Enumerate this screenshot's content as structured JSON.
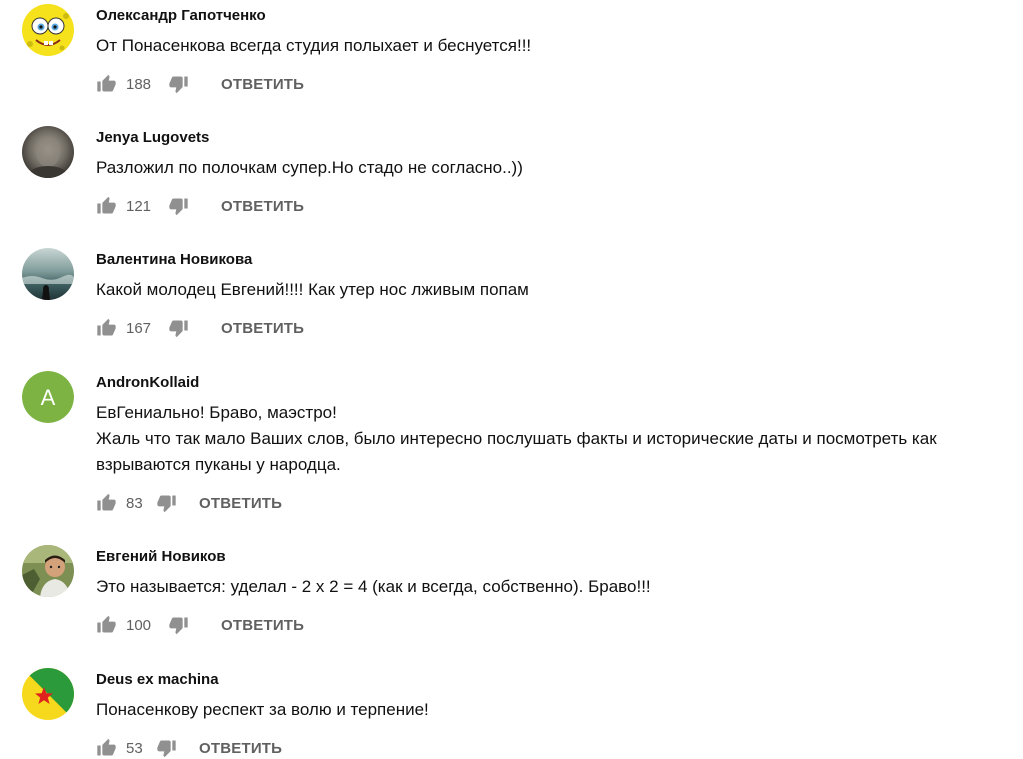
{
  "reply_label": "ОТВЕТИТЬ",
  "comments": [
    {
      "author": "Олександр Гапотченко",
      "text": [
        "От Понасенкова всегда студия полыхает и беснуется!!!"
      ],
      "likes": "188",
      "avatar": "spongebob-avatar"
    },
    {
      "author": "Jenya Lugovets",
      "text": [
        "Разложил по полочкам супер.Но стадо не согласно..))"
      ],
      "likes": "121",
      "avatar": "photo-avatar"
    },
    {
      "author": "Валентина Новикова",
      "text": [
        "Какой молодец Евгений!!!! Как утер нос лживым попам"
      ],
      "likes": "167",
      "avatar": "sea-photo-avatar"
    },
    {
      "author": "AndronKollaid",
      "text": [
        "ЕвГениально! Браво, маэстро!",
        "Жаль что так мало Ваших слов, было интересно послушать факты и исторические даты и посмотреть как",
        "взрываются пуканы у народца."
      ],
      "likes": "83",
      "avatar": "letter-avatar",
      "avatar_letter": "A",
      "avatar_color": "#7cb342"
    },
    {
      "author": "Евгений Новиков",
      "text": [
        "Это называется: уделал - 2 х 2 = 4 (как и всегда, собственно). Браво!!!"
      ],
      "likes": "100",
      "avatar": "person-photo-avatar"
    },
    {
      "author": "Deus ex machina",
      "text": [
        "Понасенкову респект за волю и терпение!"
      ],
      "likes": "53",
      "avatar": "flag-avatar"
    }
  ],
  "colors": {
    "text": "#111111",
    "secondary": "#606060",
    "icon": "#909090"
  }
}
